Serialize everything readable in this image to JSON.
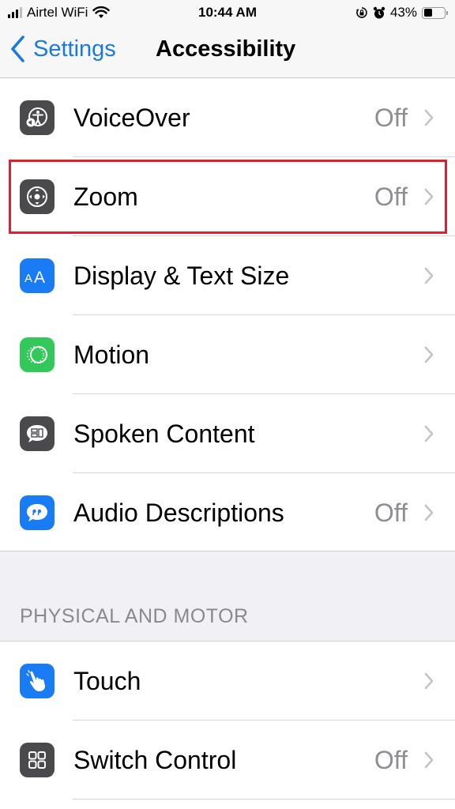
{
  "status_bar": {
    "carrier": "Airtel WiFi",
    "time": "10:44 AM",
    "battery_percent": "43%",
    "battery_level": 0.43,
    "icons": [
      "signal-icon",
      "wifi-icon",
      "orientation-lock-icon",
      "alarm-icon",
      "battery-icon"
    ]
  },
  "nav": {
    "back_label": "Settings",
    "title": "Accessibility"
  },
  "vision_items": [
    {
      "label": "VoiceOver",
      "value": "Off",
      "icon": "voiceover-icon",
      "color": "#4a4a4c"
    },
    {
      "label": "Zoom",
      "value": "Off",
      "icon": "zoom-icon",
      "color": "#4a4a4c"
    },
    {
      "label": "Display & Text Size",
      "value": "",
      "icon": "text-size-icon",
      "color": "#1a7cf5"
    },
    {
      "label": "Motion",
      "value": "",
      "icon": "motion-icon",
      "color": "#34c759"
    },
    {
      "label": "Spoken Content",
      "value": "",
      "icon": "spoken-content-icon",
      "color": "#4a4a4c"
    },
    {
      "label": "Audio Descriptions",
      "value": "Off",
      "icon": "audio-descriptions-icon",
      "color": "#1a7cf5"
    }
  ],
  "physical_section": {
    "header": "PHYSICAL AND MOTOR",
    "items": [
      {
        "label": "Touch",
        "value": "",
        "icon": "touch-icon",
        "color": "#1a7cf5"
      },
      {
        "label": "Switch Control",
        "value": "Off",
        "icon": "switch-control-icon",
        "color": "#4a4a4c"
      }
    ]
  },
  "highlight": {
    "target": "Zoom",
    "color": "#d9232e"
  }
}
